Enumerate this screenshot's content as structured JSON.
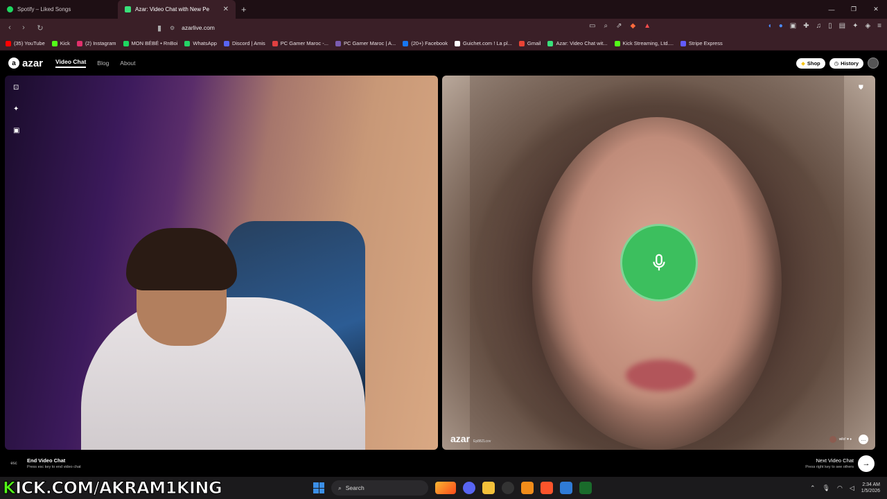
{
  "browser": {
    "tabs": [
      {
        "label": "Spotify – Liked Songs",
        "active": false
      },
      {
        "label": "Azar: Video Chat with New Pe",
        "active": true
      }
    ],
    "url": "azarlive.com",
    "bookmarks": [
      {
        "label": "(35) YouTube",
        "color": "#ff0000"
      },
      {
        "label": "Kick",
        "color": "#53fc18"
      },
      {
        "label": "(2) Instagram",
        "color": "#e1306c"
      },
      {
        "label": "MON BÉBÉ • RnBoi",
        "color": "#1ed760"
      },
      {
        "label": "WhatsApp",
        "color": "#25d366"
      },
      {
        "label": "Discord | Amis",
        "color": "#5865f2"
      },
      {
        "label": "PC Gamer Maroc -...",
        "color": "#e04040"
      },
      {
        "label": "PC Gamer Maroc | A...",
        "color": "#7a5cb0"
      },
      {
        "label": "(20+) Facebook",
        "color": "#1877f2"
      },
      {
        "label": "Guichet.com ! La pl...",
        "color": "#ffffff"
      },
      {
        "label": "Gmail",
        "color": "#ea4335"
      },
      {
        "label": "Azar: Video Chat wit...",
        "color": "#39e07a"
      },
      {
        "label": "Kick Streaming, Ltd....",
        "color": "#53fc18"
      },
      {
        "label": "Stripe Express",
        "color": "#635bff"
      }
    ]
  },
  "app": {
    "logo": "azar",
    "nav": [
      "Video Chat",
      "Blog",
      "About"
    ],
    "shop_label": "Shop",
    "history_label": "History",
    "watermark": "azar",
    "watermark_id": "Ep88ZLcov",
    "partner_badge": "wilo! ♥ ♦",
    "end": {
      "key": "esc",
      "title": "End Video Chat",
      "hint": "Press esc key to end video chat"
    },
    "next": {
      "title": "Next Video Chat",
      "hint": "Press right key to see others"
    },
    "accent": "#3cbf5e"
  },
  "overlay_text": {
    "k": "K",
    "rest": "ICK.COM/AKRAM1KING"
  },
  "taskbar": {
    "search_placeholder": "Search",
    "time": "2:34 AM",
    "date": "1/5/2026"
  }
}
